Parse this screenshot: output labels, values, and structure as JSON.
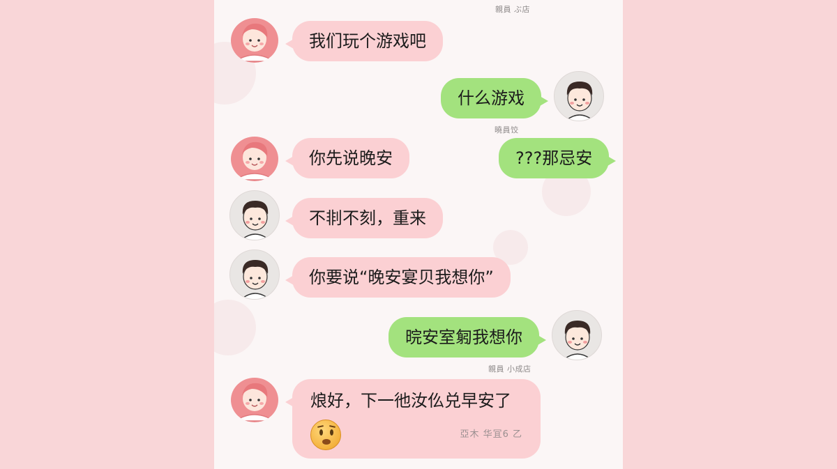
{
  "timestamps": {
    "top": "親員 ぶ店",
    "after_what_game": "曉員饺",
    "after_goodnight_reply": "親員 小成店",
    "inside_last": "亞木 华冝6 乙"
  },
  "messages": [
    {
      "sender": "her",
      "text": "我们玩个游戏吧"
    },
    {
      "sender": "me",
      "text": "什么游戏"
    },
    {
      "sender": "her",
      "text": "你先说晚安"
    },
    {
      "sender": "me",
      "text": "???那忌安"
    },
    {
      "sender": "her_with_boy_avatar",
      "text": "不剕不刻，重来"
    },
    {
      "sender": "her_with_boy_avatar",
      "text": "你要说“晚安宴贝我想你”"
    },
    {
      "sender": "me",
      "text": "晥安室匑我想你"
    },
    {
      "sender": "her",
      "text": "烺好，下一彵汝仫兑早安了",
      "emoji": "worried-smiling-face-emoji"
    }
  ],
  "colors": {
    "outer_background": "#f9d6d8",
    "panel_background": "#fbf6f6",
    "her_bubble": "#fbd0d3",
    "my_bubble": "#a3e27e"
  }
}
